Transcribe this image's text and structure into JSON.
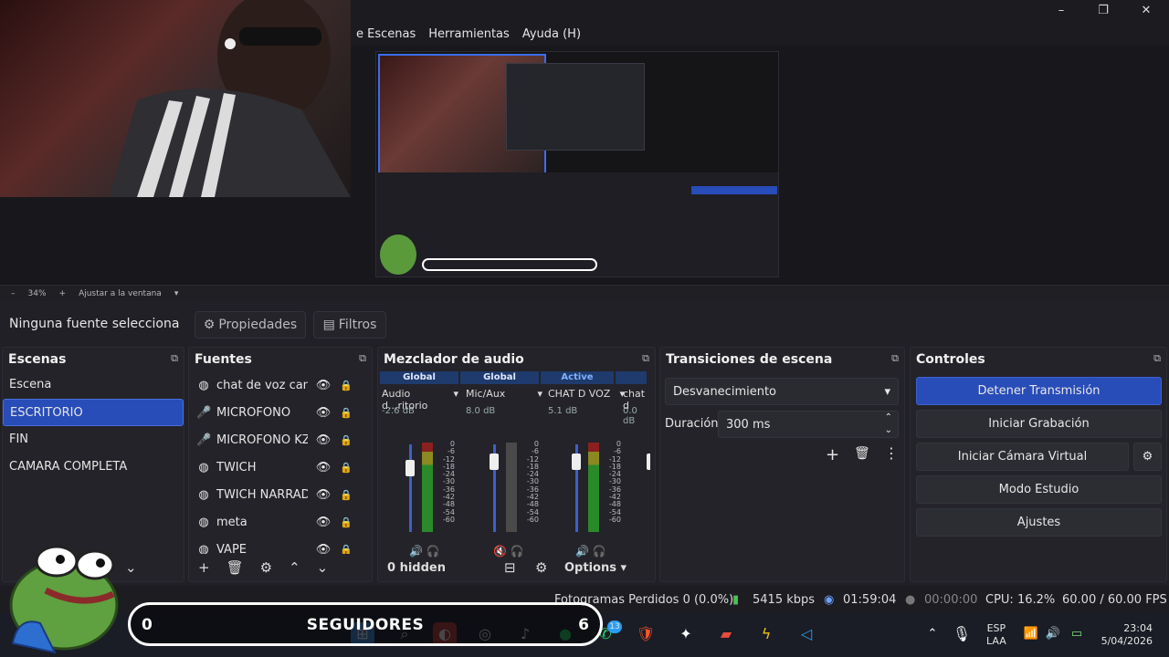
{
  "menu": [
    "e Escenas",
    "Herramientas",
    "Ayuda (H)"
  ],
  "window_controls": {
    "min": "–",
    "max": "❐",
    "close": "✕"
  },
  "zoom": {
    "minus": "–",
    "level": "34%",
    "plus": "+",
    "fit": "Ajustar a la ventana",
    "arrow": "▾"
  },
  "source_toolbar": {
    "selected": "Ninguna fuente selecciona",
    "properties": "Propiedades",
    "filters": "Filtros"
  },
  "scenes": {
    "title": "Escenas",
    "items": [
      "Escena",
      "ESCRITORIO",
      "FIN",
      "CAMARA COMPLETA"
    ],
    "selected_index": 1
  },
  "sources": {
    "title": "Fuentes",
    "items": [
      {
        "name": "chat de voz cana",
        "icon": "globe-icon"
      },
      {
        "name": "MICROFONO",
        "icon": "mic-icon"
      },
      {
        "name": "MICROFONO KZ",
        "icon": "mic-icon"
      },
      {
        "name": "TWICH",
        "icon": "globe-icon"
      },
      {
        "name": "TWICH NARRADO",
        "icon": "globe-icon"
      },
      {
        "name": "meta",
        "icon": "globe-icon"
      },
      {
        "name": "VAPE",
        "icon": "globe-icon"
      }
    ]
  },
  "mixer": {
    "title": "Mezclador de audio",
    "headers": [
      "Global",
      "Global",
      "Active"
    ],
    "channels": [
      {
        "name": "Audio d...ritorio",
        "db": "-2.6 dB",
        "level": 0.82,
        "muted": false
      },
      {
        "name": "Mic/Aux",
        "db": "8.0 dB",
        "level": 0.9,
        "muted": true
      },
      {
        "name": "CHAT D VOZ",
        "db": "5.1 dB",
        "level": 0.9,
        "muted": false
      },
      {
        "name": "chat d",
        "db": "0.0 dB",
        "level": 0.9,
        "muted": false
      }
    ],
    "scale": [
      "0",
      "-6",
      "-12",
      "-18",
      "-24",
      "-30",
      "-36",
      "-42",
      "-48",
      "-54",
      "-60"
    ],
    "hidden": "0 hidden",
    "options": "Options"
  },
  "transitions": {
    "title": "Transiciones de escena",
    "selected": "Desvanecimiento",
    "duration_label": "Duración",
    "duration_value": "300 ms"
  },
  "controls": {
    "title": "Controles",
    "stop_stream": "Detener Transmisión",
    "start_record": "Iniciar Grabación",
    "virtual_cam": "Iniciar Cámara Virtual",
    "studio": "Modo Estudio",
    "settings": "Ajustes"
  },
  "status": {
    "dropped": "Fotogramas Perdidos 0 (0.0%)",
    "bitrate": "5415 kbps",
    "stream_time": "01:59:04",
    "rec_time": "00:00:00",
    "cpu": "CPU: 16.2%",
    "fps": "60.00 / 60.00 FPS"
  },
  "overlay": {
    "left": "0",
    "title": "SEGUIDORES",
    "right": "6"
  },
  "taskbar": {
    "lang1": "ESP",
    "lang2": "LAA",
    "time": "23:04",
    "date": "5/04/2026",
    "badge": "13"
  },
  "colors": {
    "accent": "#284cb8",
    "panel": "#232329",
    "bg": "#202026"
  }
}
